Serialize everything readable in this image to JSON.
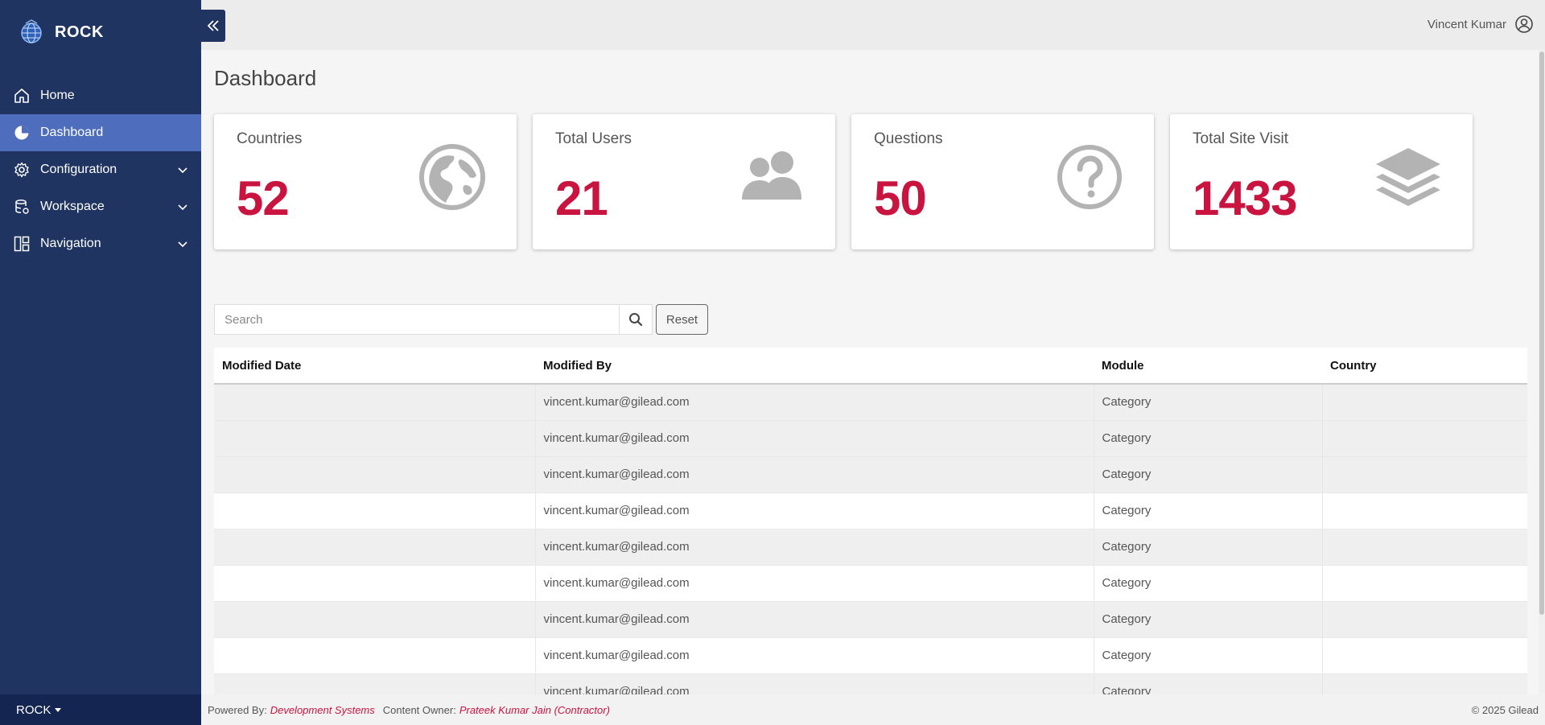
{
  "brand": {
    "name": "ROCK"
  },
  "sidebar": {
    "items": [
      {
        "label": "Home",
        "icon": "home-icon"
      },
      {
        "label": "Dashboard",
        "icon": "pie-chart-icon",
        "active": true
      },
      {
        "label": "Configuration",
        "icon": "gear-icon",
        "expandable": true
      },
      {
        "label": "Workspace",
        "icon": "database-icon",
        "expandable": true
      },
      {
        "label": "Navigation",
        "icon": "layout-icon",
        "expandable": true
      }
    ],
    "footer_label": "ROCK"
  },
  "header": {
    "user_name": "Vincent Kumar"
  },
  "page": {
    "title": "Dashboard"
  },
  "cards": [
    {
      "title": "Countries",
      "value": "52",
      "icon": "globe-icon"
    },
    {
      "title": "Total Users",
      "value": "21",
      "icon": "users-icon"
    },
    {
      "title": "Questions",
      "value": "50",
      "icon": "question-icon"
    },
    {
      "title": "Total Site Visit",
      "value": "1433",
      "icon": "layers-icon"
    }
  ],
  "search": {
    "placeholder": "Search",
    "value": "",
    "reset_label": "Reset"
  },
  "table": {
    "columns": [
      "Modified Date",
      "Modified By",
      "Module",
      "Country"
    ],
    "rows": [
      [
        "",
        "vincent.kumar@gilead.com",
        "Category",
        ""
      ],
      [
        "",
        "vincent.kumar@gilead.com",
        "Category",
        ""
      ],
      [
        "",
        "vincent.kumar@gilead.com",
        "Category",
        ""
      ],
      [
        "",
        "vincent.kumar@gilead.com",
        "Category",
        ""
      ],
      [
        "",
        "vincent.kumar@gilead.com",
        "Category",
        ""
      ],
      [
        "",
        "vincent.kumar@gilead.com",
        "Category",
        ""
      ],
      [
        "",
        "vincent.kumar@gilead.com",
        "Category",
        ""
      ],
      [
        "",
        "vincent.kumar@gilead.com",
        "Category",
        ""
      ],
      [
        "",
        "vincent.kumar@gilead.com",
        "Category",
        ""
      ]
    ]
  },
  "footer": {
    "powered_by_label": "Powered By:",
    "powered_by_value": "Development Systems",
    "content_owner_label": "Content Owner:",
    "content_owner_value": "Prateek Kumar Jain (Contractor)",
    "copyright": "© 2025 Gilead"
  },
  "colors": {
    "sidebar": "#1f3461",
    "active": "#4e6dbd",
    "accent": "#c8143f"
  }
}
